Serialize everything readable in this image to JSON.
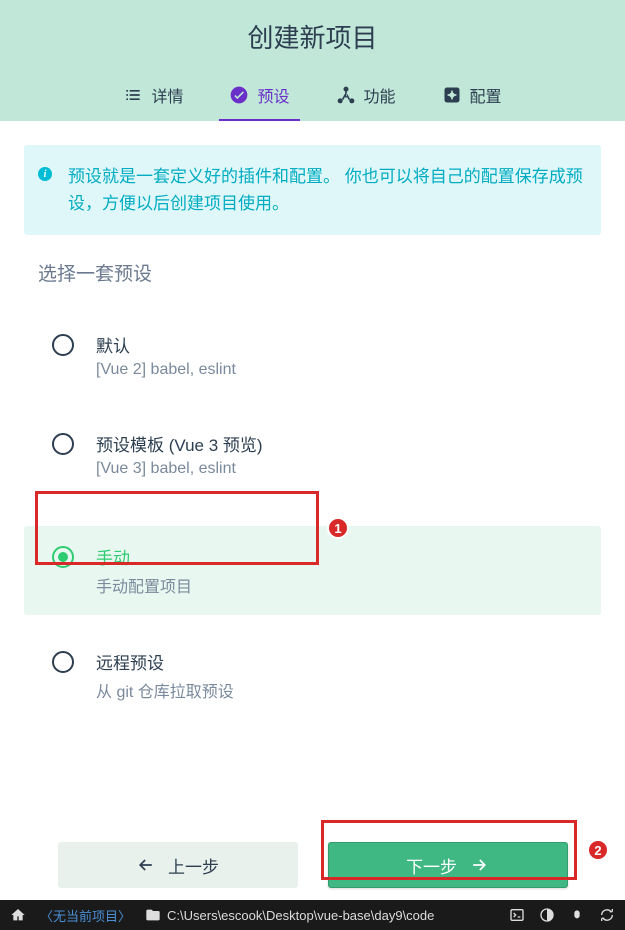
{
  "header": {
    "title": "创建新项目",
    "tabs": [
      {
        "id": "details",
        "label": "详情"
      },
      {
        "id": "presets",
        "label": "预设"
      },
      {
        "id": "features",
        "label": "功能"
      },
      {
        "id": "config",
        "label": "配置"
      }
    ],
    "active_tab": "presets"
  },
  "info": {
    "text": "预设就是一套定义好的插件和配置。 你也可以将自己的配置保存成预设，方便以后创建项目使用。"
  },
  "section": {
    "title": "选择一套预设"
  },
  "options": [
    {
      "id": "default",
      "title": "默认",
      "desc": "[Vue 2] babel, eslint",
      "selected": false
    },
    {
      "id": "vue3preview",
      "title": "预设模板 (Vue 3 预览)",
      "desc": "[Vue 3] babel, eslint",
      "selected": false
    },
    {
      "id": "manual",
      "title": "手动",
      "desc": "手动配置项目",
      "selected": true
    },
    {
      "id": "remote",
      "title": "远程预设",
      "desc": "从 git 仓库拉取预设",
      "selected": false
    }
  ],
  "buttons": {
    "back": "上一步",
    "next": "下一步"
  },
  "annotations": {
    "badge1": "1",
    "badge2": "2"
  },
  "statusbar": {
    "no_project": "〈无当前项目〉",
    "path": "C:\\Users\\escook\\Desktop\\vue-base\\day9\\code"
  }
}
